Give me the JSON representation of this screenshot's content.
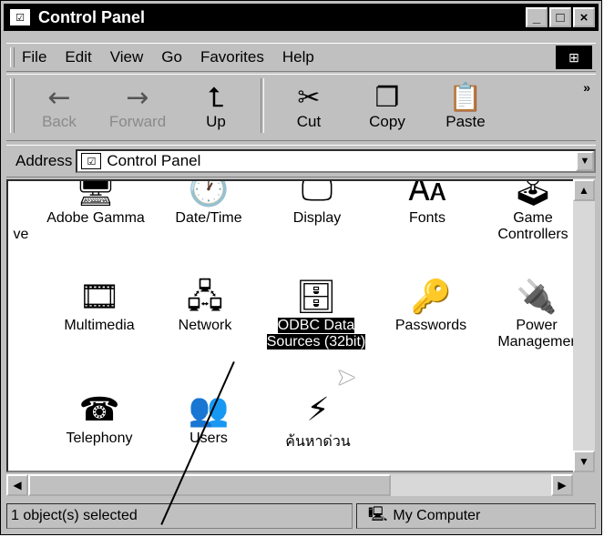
{
  "window": {
    "title": "Control Panel"
  },
  "menu": [
    "File",
    "Edit",
    "View",
    "Go",
    "Favorites",
    "Help"
  ],
  "toolbar": {
    "back": "Back",
    "forward": "Forward",
    "up": "Up",
    "cut": "Cut",
    "copy": "Copy",
    "paste": "Paste"
  },
  "address": {
    "label": "Address",
    "value": "Control Panel"
  },
  "icons": {
    "partial": "ve",
    "adobe_gamma": "Adobe Gamma",
    "datetime": "Date/Time",
    "display": "Display",
    "fonts": "Fonts",
    "game_controllers_1": "Game",
    "game_controllers_2": "Controllers",
    "multimedia": "Multimedia",
    "network": "Network",
    "odbc_1": "ODBC Data",
    "odbc_2": "Sources (32bit)",
    "passwords": "Passwords",
    "power_1": "Power",
    "power_2": "Managemer",
    "telephony": "Telephony",
    "users": "Users",
    "find_fast": "ค้นหาด่วน"
  },
  "status": {
    "selection": "1 object(s) selected",
    "zone": "My Computer"
  },
  "icon_names": [
    "control-panel-icon",
    "back-arrow-icon",
    "forward-arrow-icon",
    "up-folder-icon",
    "scissors-icon",
    "copy-icon",
    "paste-icon",
    "monitor-icon",
    "clock-icon",
    "display-icon",
    "fonts-icon",
    "joystick-icon",
    "multimedia-icon",
    "network-icon",
    "odbc-icon",
    "keys-icon",
    "power-plug-icon",
    "telephone-icon",
    "users-icon",
    "binoculars-icon",
    "computer-icon",
    "windows-flag-icon"
  ]
}
